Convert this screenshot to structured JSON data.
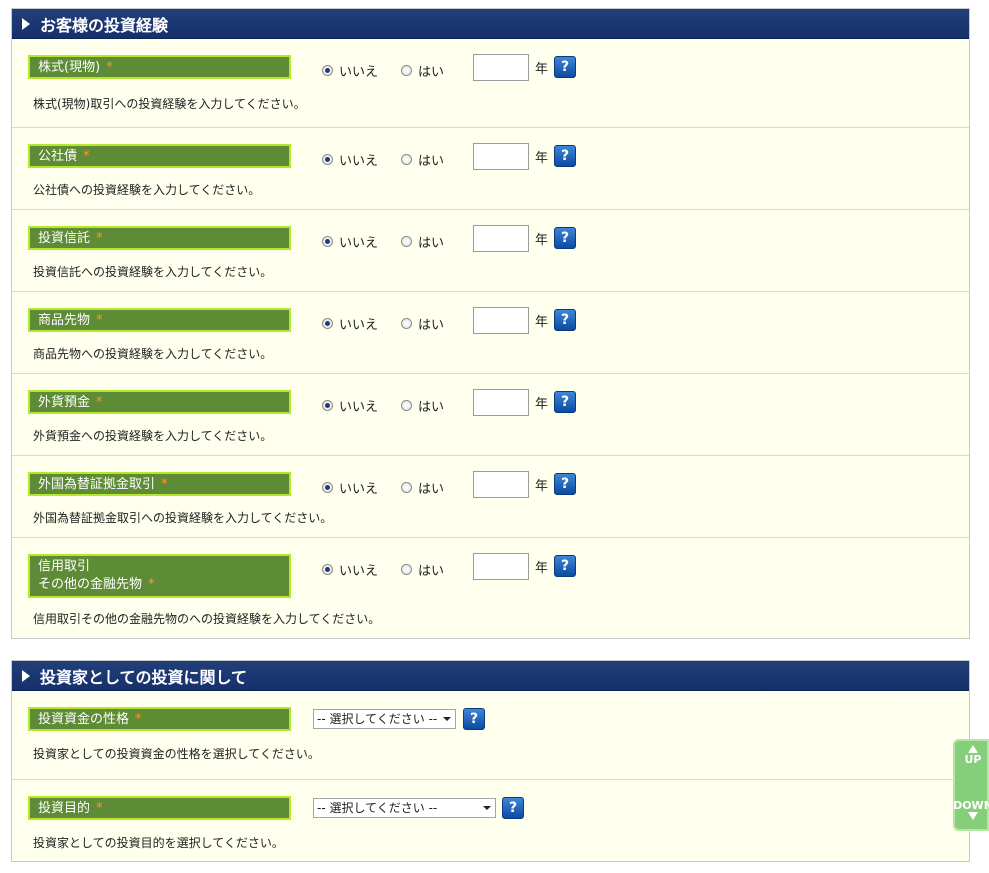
{
  "section1": {
    "title": "お客様の投資経験",
    "rows": [
      {
        "label": "株式(現物)",
        "required": "*",
        "no": "いいえ",
        "yes": "はい",
        "unit": "年",
        "help": "?",
        "desc": "株式(現物)取引への投資経験を入力してください。"
      },
      {
        "label": "公社債",
        "required": "*",
        "no": "いいえ",
        "yes": "はい",
        "unit": "年",
        "help": "?",
        "desc": "公社債への投資経験を入力してください。"
      },
      {
        "label": "投資信託",
        "required": "*",
        "no": "いいえ",
        "yes": "はい",
        "unit": "年",
        "help": "?",
        "desc": "投資信託への投資経験を入力してください。"
      },
      {
        "label": "商品先物",
        "required": "*",
        "no": "いいえ",
        "yes": "はい",
        "unit": "年",
        "help": "?",
        "desc": "商品先物への投資経験を入力してください。"
      },
      {
        "label": "外貨預金",
        "required": "*",
        "no": "いいえ",
        "yes": "はい",
        "unit": "年",
        "help": "?",
        "desc": "外貨預金への投資経験を入力してください。"
      },
      {
        "label": "外国為替証拠金取引",
        "required": "*",
        "no": "いいえ",
        "yes": "はい",
        "unit": "年",
        "help": "?",
        "desc": "外国為替証拠金取引への投資経験を入力してください。"
      },
      {
        "label_line1": "信用取引",
        "label_line2": "その他の金融先物",
        "required": "*",
        "no": "いいえ",
        "yes": "はい",
        "unit": "年",
        "help": "?",
        "desc": "信用取引その他の金融先物のへの投資経験を入力してください。"
      }
    ]
  },
  "section2": {
    "title": "投資家としての投資に関して",
    "rows": [
      {
        "label": "投資資金の性格",
        "required": "*",
        "select": "-- 選択してください --",
        "help": "?",
        "desc": "投資家としての投資資金の性格を選択してください。"
      },
      {
        "label": "投資目的",
        "required": "*",
        "select": "-- 選択してください --",
        "help": "?",
        "desc": "投資家としての投資目的を選択してください。"
      }
    ]
  },
  "scroller": {
    "up": "UP",
    "down": "DOWN"
  },
  "colors": {
    "header": "#1a3570",
    "label_bg": "#5d8b36",
    "label_border": "#b7e62a",
    "section_bg": "#ffffee",
    "required": "#ff9a22"
  }
}
